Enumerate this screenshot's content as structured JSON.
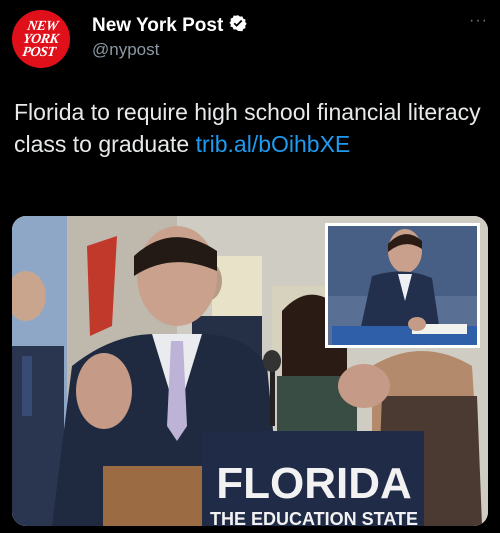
{
  "header": {
    "display_name": "New York Post",
    "handle": "@nypost",
    "verified_icon": "verified-badge-icon",
    "more_label": "···",
    "logo_lines": [
      "NEW",
      "YORK",
      "POST"
    ]
  },
  "tweet": {
    "text": "Florida to require high school financial literacy class to graduate ",
    "link": "trib.al/bOihbXE"
  },
  "media": {
    "podium_title": "FLORIDA",
    "podium_subtitle": "THE EDUCATION STATE"
  },
  "colors": {
    "background": "#000000",
    "accent": "#1d9bf0",
    "logo_red": "#e0101a",
    "podium_navy": "#1f2b47"
  }
}
